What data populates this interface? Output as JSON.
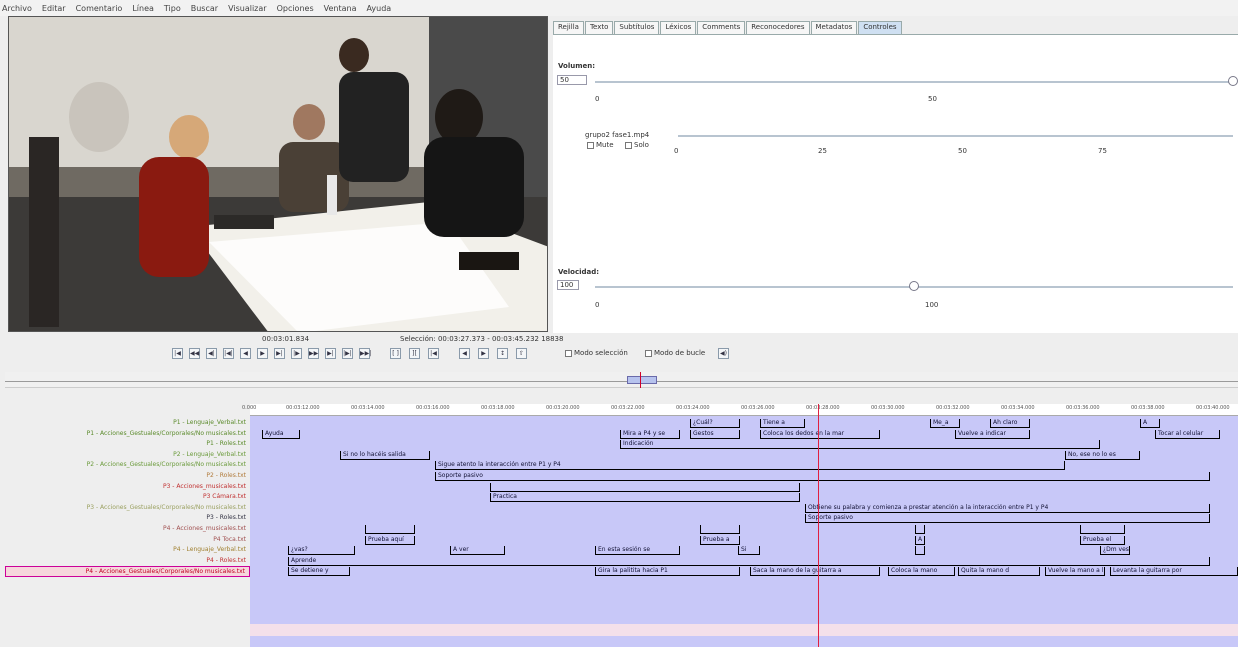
{
  "menu": [
    "Archivo",
    "Editar",
    "Comentario",
    "Línea",
    "Tipo",
    "Buscar",
    "Visualizar",
    "Opciones",
    "Ventana",
    "Ayuda"
  ],
  "tabs": [
    {
      "label": "Rejilla",
      "active": false
    },
    {
      "label": "Texto",
      "active": false
    },
    {
      "label": "Subtítulos",
      "active": false
    },
    {
      "label": "Léxicos",
      "active": false
    },
    {
      "label": "Comments",
      "active": false
    },
    {
      "label": "Reconocedores",
      "active": false
    },
    {
      "label": "Metadatos",
      "active": false
    },
    {
      "label": "Controles",
      "active": true
    }
  ],
  "controls": {
    "volume_label": "Volumen:",
    "volume_value": "50",
    "volume_ticks": [
      "0",
      "50"
    ],
    "volume_level": 1.0,
    "media_file": "grupo2 fase1.mp4",
    "mute_label": "Mute",
    "solo_label": "Solo",
    "media_ticks": [
      "0",
      "25",
      "50",
      "75"
    ],
    "rate_label": "Velocidad:",
    "rate_value": "100",
    "rate_ticks": [
      "0",
      "100"
    ],
    "rate_level": 0.5
  },
  "transport": {
    "time": "00:03:01.834",
    "selection": "Selección: 00:03:27.373 - 00:03:45.232  18838",
    "selection_mode": "Modo selección",
    "loop_mode": "Modo de bucle"
  },
  "ruler_ticks": [
    "0.000",
    "00:03:12.000",
    "00:03:14.000",
    "00:03:16.000",
    "00:03:18.000",
    "00:03:20.000",
    "00:03:22.000",
    "00:03:24.000",
    "00:03:26.000",
    "00:03:28.000",
    "00:03:30.000",
    "00:03:32.000",
    "00:03:34.000",
    "00:03:36.000",
    "00:03:38.000",
    "00:03:40.000"
  ],
  "tiers": [
    {
      "label": "P1 - Lenguaje_Verbal.txt",
      "color": "#5a8a2a"
    },
    {
      "label": "P1 - Acciones_Gestuales/Corporales/No musicales.txt",
      "color": "#5a8a2a"
    },
    {
      "label": "P1 - Roles.txt",
      "color": "#5a8a2a"
    },
    {
      "label": "P2 - Lenguaje_Verbal.txt",
      "color": "#6a9a3a"
    },
    {
      "label": "P2 - Acciones_Gestuales/Corporales/No musicales.txt",
      "color": "#6a9a3a"
    },
    {
      "label": "P2 - Roles.txt",
      "color": "#b07a3a"
    },
    {
      "label": "P3 - Acciones_musicales.txt",
      "color": "#c03030"
    },
    {
      "label": "P3 Cámara.txt",
      "color": "#c03030"
    },
    {
      "label": "P3 - Acciones_Gestuales/Corporales/No musicales.txt",
      "color": "#9aa060"
    },
    {
      "label": "P3 - Roles.txt",
      "color": "#334"
    },
    {
      "label": "P4 - Acciones_musicales.txt",
      "color": "#a05050"
    },
    {
      "label": "P4 Toca.txt",
      "color": "#a05050"
    },
    {
      "label": "P4 - Lenguaje_Verbal.txt",
      "color": "#a08030"
    },
    {
      "label": "P4 - Roles.txt",
      "color": "#c03030"
    },
    {
      "label": "P4 - Acciones_Gestuales/Corporales/No musicales.txt",
      "color": "#c00020",
      "active": true
    }
  ],
  "annotations": [
    {
      "row": 0,
      "text": "¿Cuál?",
      "s": 690,
      "e": 740
    },
    {
      "row": 0,
      "text": "Tiene a",
      "s": 760,
      "e": 805
    },
    {
      "row": 0,
      "text": "Me_a",
      "s": 930,
      "e": 960
    },
    {
      "row": 0,
      "text": "Ah claro",
      "s": 990,
      "e": 1030
    },
    {
      "row": 0,
      "text": "A",
      "s": 1140,
      "e": 1160
    },
    {
      "row": 1,
      "text": "Ayuda",
      "s": 262,
      "e": 300
    },
    {
      "row": 1,
      "text": "Mira a P4 y se",
      "s": 620,
      "e": 680
    },
    {
      "row": 1,
      "text": "Gestos",
      "s": 690,
      "e": 740
    },
    {
      "row": 1,
      "text": "Coloca los dedos en la mar",
      "s": 760,
      "e": 880
    },
    {
      "row": 1,
      "text": "Vuelve a indicar",
      "s": 955,
      "e": 1030
    },
    {
      "row": 1,
      "text": "Tocar al celular",
      "s": 1155,
      "e": 1220
    },
    {
      "row": 2,
      "text": "Indicación",
      "s": 620,
      "e": 1100
    },
    {
      "row": 3,
      "text": "Si no lo hacéis salida",
      "s": 340,
      "e": 430
    },
    {
      "row": 3,
      "text": "No, ese no lo es",
      "s": 1065,
      "e": 1140
    },
    {
      "row": 4,
      "text": "Sigue atento la interacción entre P1 y P4",
      "s": 435,
      "e": 1065
    },
    {
      "row": 5,
      "text": "Soporte pasivo",
      "s": 435,
      "e": 1210
    },
    {
      "row": 6,
      "text": "",
      "s": 490,
      "e": 800
    },
    {
      "row": 7,
      "text": "Practica",
      "s": 490,
      "e": 800
    },
    {
      "row": 8,
      "text": "Obtiene su palabra y comienza a prestar atención a la interacción entre P1 y P4",
      "s": 805,
      "e": 1210
    },
    {
      "row": 9,
      "text": "Soporte pasivo",
      "s": 805,
      "e": 1210
    },
    {
      "row": 10,
      "text": "",
      "s": 365,
      "e": 415
    },
    {
      "row": 10,
      "text": "",
      "s": 700,
      "e": 740
    },
    {
      "row": 10,
      "text": "",
      "s": 915,
      "e": 925
    },
    {
      "row": 10,
      "text": "",
      "s": 1080,
      "e": 1125
    },
    {
      "row": 11,
      "text": "Prueba aquí",
      "s": 365,
      "e": 415
    },
    {
      "row": 11,
      "text": "Prueba a",
      "s": 700,
      "e": 740
    },
    {
      "row": 11,
      "text": "A",
      "s": 915,
      "e": 925
    },
    {
      "row": 11,
      "text": "Prueba el",
      "s": 1080,
      "e": 1125
    },
    {
      "row": 12,
      "text": "¿vas?",
      "s": 288,
      "e": 355
    },
    {
      "row": 12,
      "text": "A ver",
      "s": 450,
      "e": 505
    },
    {
      "row": 12,
      "text": "En esta sesión se",
      "s": 595,
      "e": 680
    },
    {
      "row": 12,
      "text": "Si",
      "s": 738,
      "e": 760
    },
    {
      "row": 12,
      "text": "",
      "s": 915,
      "e": 925
    },
    {
      "row": 12,
      "text": "¿Dm ves",
      "s": 1100,
      "e": 1130
    },
    {
      "row": 13,
      "text": "Aprende",
      "s": 288,
      "e": 1210
    },
    {
      "row": 14,
      "text": "Se detiene y",
      "s": 288,
      "e": 350
    },
    {
      "row": 14,
      "text": "Gira la palitita hacia P1",
      "s": 595,
      "e": 740
    },
    {
      "row": 14,
      "text": "Saca la mano de la guitarra a",
      "s": 750,
      "e": 880
    },
    {
      "row": 14,
      "text": "Coloca la mano",
      "s": 888,
      "e": 955
    },
    {
      "row": 14,
      "text": "Quita la mano d",
      "s": 958,
      "e": 1040
    },
    {
      "row": 14,
      "text": "Vuelve la mano a l",
      "s": 1045,
      "e": 1105
    },
    {
      "row": 14,
      "text": "Levanta la guitarra por",
      "s": 1110,
      "e": 1238
    }
  ]
}
